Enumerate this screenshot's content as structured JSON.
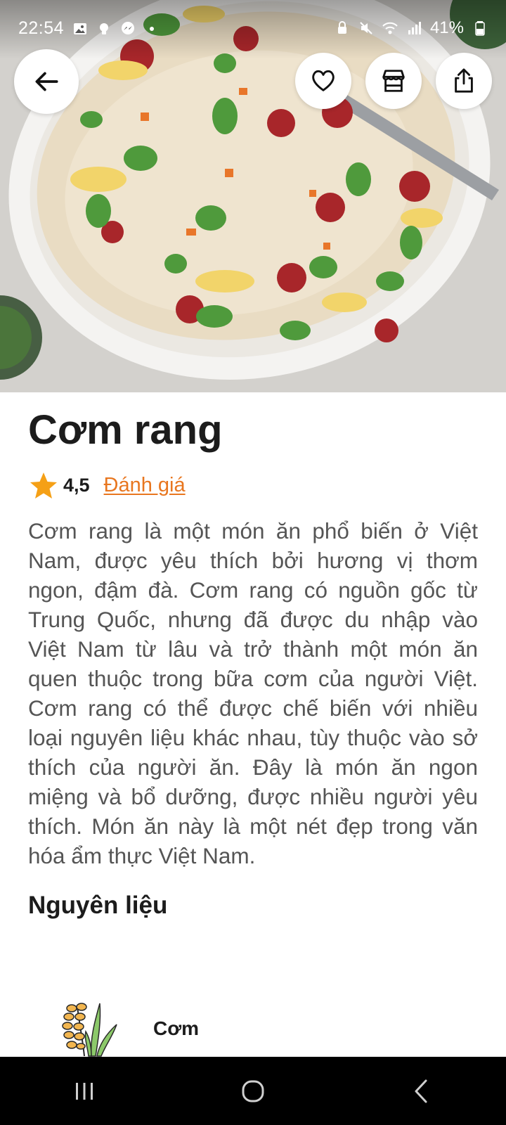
{
  "status_bar": {
    "time": "22:54",
    "battery": "41%",
    "left_icons": [
      "gallery-icon",
      "bulb-icon",
      "messenger-icon",
      "dot-icon"
    ],
    "right_icons": [
      "vpn-icon",
      "mute-icon",
      "wifi-icon",
      "signal-icon",
      "battery-icon"
    ]
  },
  "hero": {
    "dish_image": "fried-rice-photo"
  },
  "top_actions": {
    "back": "arrow-left-icon",
    "favorite": "heart-icon",
    "store": "store-icon",
    "share": "share-icon"
  },
  "recipe": {
    "title": "Cơm rang",
    "rating": "4,5",
    "rating_link": "Đánh giá",
    "description": "Cơm rang là một món ăn phổ biến ở Việt Nam, được yêu thích bởi hương vị thơm ngon, đậm đà. Cơm rang có nguồn gốc từ Trung Quốc, nhưng đã được du nhập vào Việt Nam từ lâu và trở thành một món ăn quen thuộc trong bữa cơm của người Việt. Cơm rang có thể được chế biến với nhiều loại nguyên liệu khác nhau, tùy thuộc vào sở thích của người ăn. Đây là món ăn ngon miệng và bổ dưỡng, được nhiều người yêu thích. Món ăn này là một nét đẹp trong văn hóa ẩm thực Việt Nam.",
    "ingredients_title": "Nguyên liệu",
    "ingredients": [
      {
        "name": "Cơm",
        "icon": "rice-plant-icon"
      }
    ]
  },
  "colors": {
    "accent": "#e8761f",
    "star": "#f5a016",
    "text_primary": "#1c1c1c",
    "text_secondary": "#555555"
  },
  "nav_bar": {
    "buttons": [
      "recents-icon",
      "home-icon",
      "back-icon"
    ]
  }
}
